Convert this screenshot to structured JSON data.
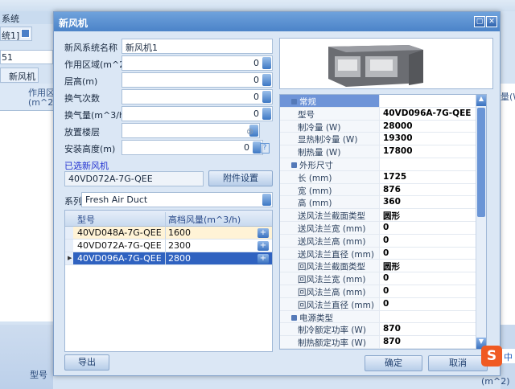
{
  "background": {
    "app_title": "系统",
    "doc_tab": "统1]",
    "field_value": "51",
    "tab_fresh_air": "新风机",
    "col_area": "作用区",
    "col_area_unit": "(m^2)",
    "right_col": "量(W",
    "bottom_col_model": "型号",
    "bottom_col_unit": "(m^2)",
    "ime_label": "中"
  },
  "dialog": {
    "title": "新风机",
    "fields": [
      {
        "label": "新风系统名称",
        "value": "新风机1"
      },
      {
        "label": "作用区域(m^2)",
        "value": "0"
      },
      {
        "label": "层高(m)",
        "value": "0"
      },
      {
        "label": "换气次数",
        "value": "0"
      },
      {
        "label": "换气量(m^3/h)",
        "value": "0"
      },
      {
        "label": "放置楼层",
        "value": ""
      },
      {
        "label": "安装高度(m)",
        "value": "0"
      }
    ],
    "selected_label": "已选新风机",
    "selected_value": "40VD072A-7G-QEE",
    "accessory_button": "附件设置",
    "series_label": "系列",
    "series_value": "Fresh Air Duct",
    "grid": {
      "headers": [
        "型号",
        "高档风量(m^3/h)"
      ],
      "rows": [
        {
          "model": "40VD048A-7G-QEE",
          "airflow": "1600",
          "add": "+"
        },
        {
          "model": "40VD072A-7G-QEE",
          "airflow": "2300",
          "add": "+"
        },
        {
          "model": "40VD096A-7G-QEE",
          "airflow": "2800",
          "add": "+"
        }
      ],
      "selected_row": 2
    },
    "export_button": "导出",
    "ok_button": "确定",
    "cancel_button": "取消",
    "properties": [
      {
        "category": "常规"
      },
      {
        "label": "型号",
        "value": "40VD096A-7G-QEE"
      },
      {
        "label": "制冷量 (W)",
        "value": "28000"
      },
      {
        "label": "显热制冷量 (W)",
        "value": "19300"
      },
      {
        "label": "制热量 (W)",
        "value": "17800"
      },
      {
        "category": "外形尺寸"
      },
      {
        "label": "长 (mm)",
        "value": "1725"
      },
      {
        "label": "宽 (mm)",
        "value": "876"
      },
      {
        "label": "高 (mm)",
        "value": "360"
      },
      {
        "label": "送风法兰截面类型",
        "value": "圆形"
      },
      {
        "label": "送风法兰宽 (mm)",
        "value": "0"
      },
      {
        "label": "送风法兰高 (mm)",
        "value": "0"
      },
      {
        "label": "送风法兰直径 (mm)",
        "value": "0"
      },
      {
        "label": "回风法兰截面类型",
        "value": "圆形"
      },
      {
        "label": "回风法兰宽 (mm)",
        "value": "0"
      },
      {
        "label": "回风法兰高 (mm)",
        "value": "0"
      },
      {
        "label": "回风法兰直径 (mm)",
        "value": "0"
      },
      {
        "category": "电源类型"
      },
      {
        "label": "制冷额定功率 (W)",
        "value": "870"
      },
      {
        "label": "制热额定功率 (W)",
        "value": "870"
      }
    ]
  }
}
